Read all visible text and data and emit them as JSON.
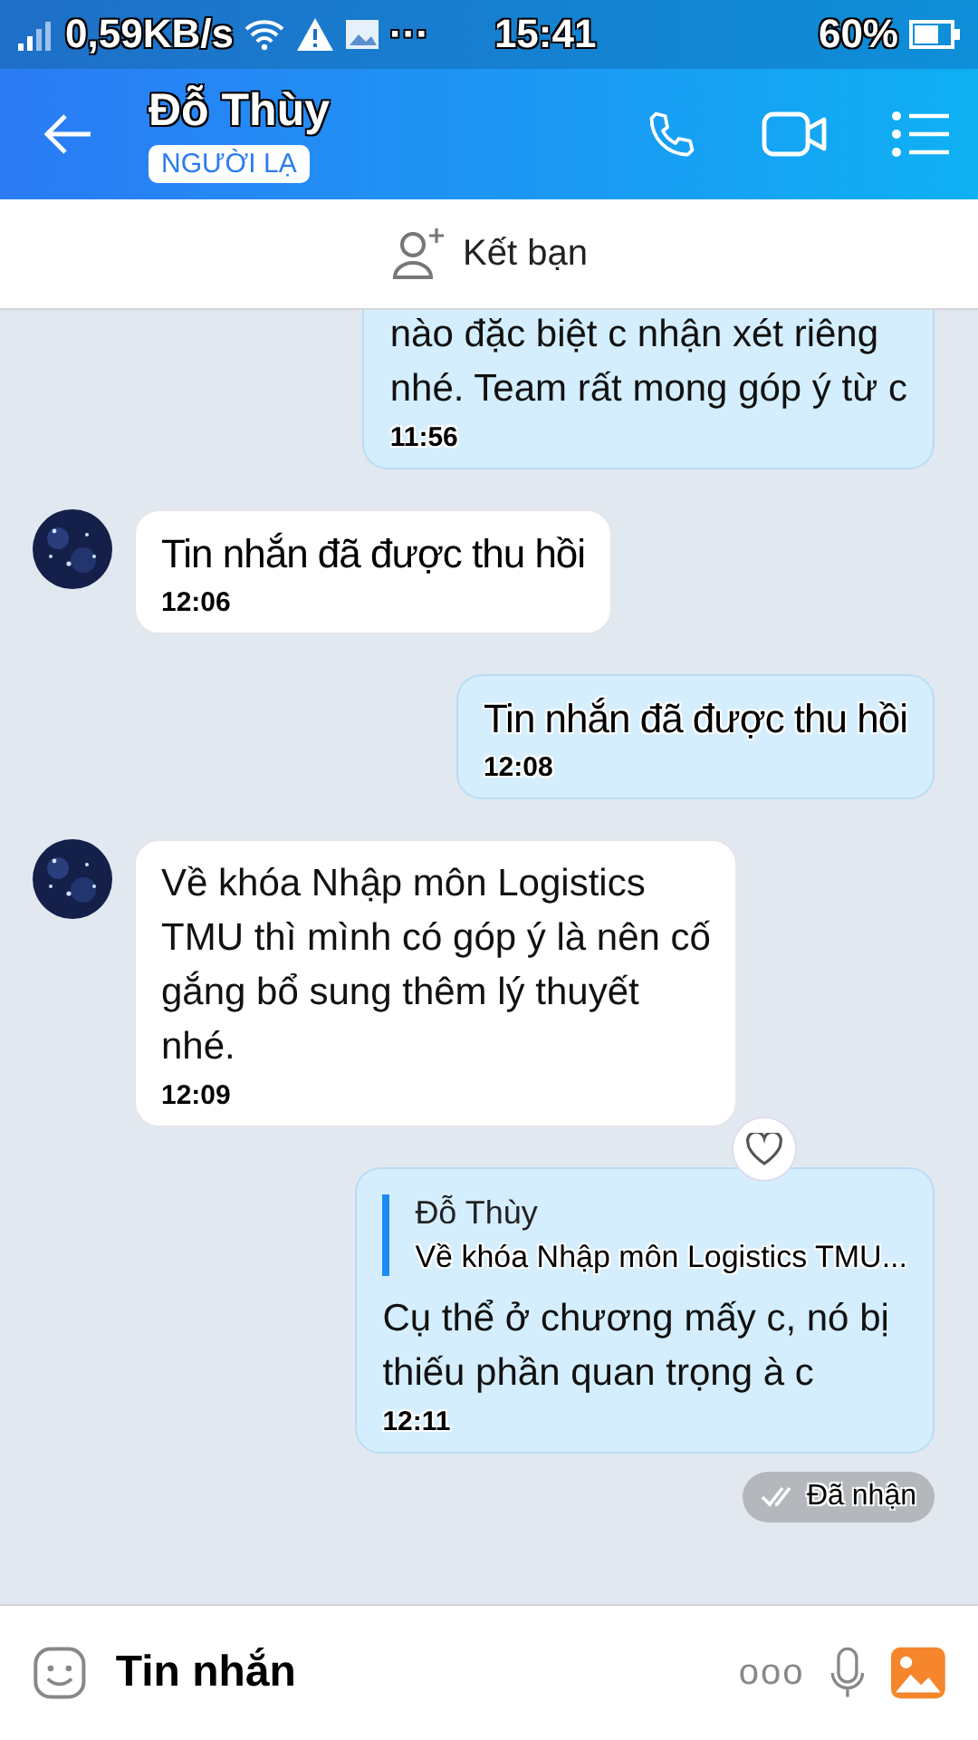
{
  "status_bar": {
    "speed": "0,59KB/s",
    "more": "···",
    "time": "15:41",
    "battery": "60%"
  },
  "header": {
    "title": "Đỗ Thùy",
    "badge": "NGƯỜI LẠ"
  },
  "add_friend": {
    "label": "Kết bạn"
  },
  "messages": [
    {
      "kind": "text",
      "outgoing": true,
      "cut_top": true,
      "avatar": false,
      "lines": [
        "nào đặc biệt c nhận xét riêng",
        "nhé. Team rất mong góp ý từ c"
      ],
      "time": "11:56"
    },
    {
      "kind": "recalled",
      "outgoing": false,
      "avatar": true,
      "lines": [
        "Tin nhắn đã được thu hồi"
      ],
      "time": "12:06"
    },
    {
      "kind": "recalled",
      "outgoing": true,
      "avatar": false,
      "lines": [
        "Tin nhắn đã được thu hồi"
      ],
      "time": "12:08"
    },
    {
      "kind": "text",
      "outgoing": false,
      "avatar": true,
      "lines": [
        "Về khóa Nhập môn Logistics",
        "TMU thì mình có góp ý là nên cố",
        "gắng bổ sung thêm lý thuyết",
        "nhé."
      ],
      "time": "12:09",
      "reaction": true
    },
    {
      "kind": "reply",
      "outgoing": true,
      "avatar": false,
      "quote_name": "Đỗ Thùy",
      "quote_text": "Về khóa Nhập môn Logistics TMU...",
      "lines": [
        "Cụ thể ở chương mấy c, nó bị",
        "thiếu phần quan trọng à c"
      ],
      "time": "12:11"
    }
  ],
  "receipt": {
    "label": "Đã nhận"
  },
  "composer": {
    "placeholder": "Tin nhắn",
    "more": "ooo"
  }
}
